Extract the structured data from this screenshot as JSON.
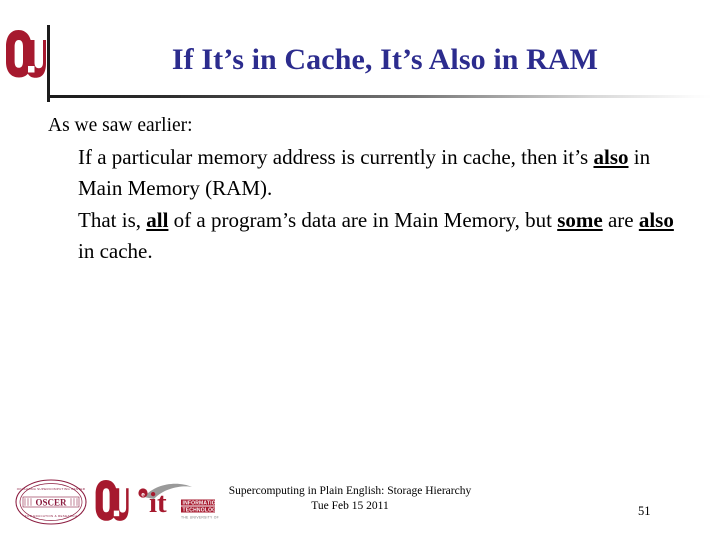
{
  "slide": {
    "title": "If It’s in Cache, It’s Also in RAM",
    "title_color": "#2c2c8e",
    "background_color": "#ffffff",
    "number": "51"
  },
  "header": {
    "ou_logo_name": "ou-logo",
    "ou_logo_color": "#a6192e",
    "rule_color": "#1a1a1a"
  },
  "body": {
    "lead": "As we saw earlier:",
    "bullets": [
      {
        "parts": [
          {
            "text": "If a particular memory address is currently in cache, then it’s ",
            "emphasis": false
          },
          {
            "text": "also",
            "emphasis": true
          },
          {
            "text": " in Main Memory (RAM).",
            "emphasis": false
          }
        ]
      },
      {
        "parts": [
          {
            "text": "That is, ",
            "emphasis": false
          },
          {
            "text": "all",
            "emphasis": true
          },
          {
            "text": " of a program’s data are in Main Memory, but ",
            "emphasis": false
          },
          {
            "text": "some",
            "emphasis": true
          },
          {
            "text": " are ",
            "emphasis": false
          },
          {
            "text": "also",
            "emphasis": true
          },
          {
            "text": " in cache.",
            "emphasis": false
          }
        ]
      }
    ]
  },
  "footer": {
    "line1": "Supercomputing in Plain English: Storage Hierarchy",
    "line2": "Tue Feb 15 2011",
    "logos": [
      {
        "name": "oscer-seal-logo",
        "label": "OSCER",
        "color": "#8c1d40"
      },
      {
        "name": "ou-logo",
        "label": "OU",
        "color": "#a6192e"
      },
      {
        "name": "ou-information-technology-logo",
        "label": "it",
        "sub1": "INFORMATION",
        "sub2": "TECHNOLOGY",
        "sub3": "THE UNIVERSITY OF OKLAHOMA",
        "color": "#a6192e"
      }
    ]
  }
}
